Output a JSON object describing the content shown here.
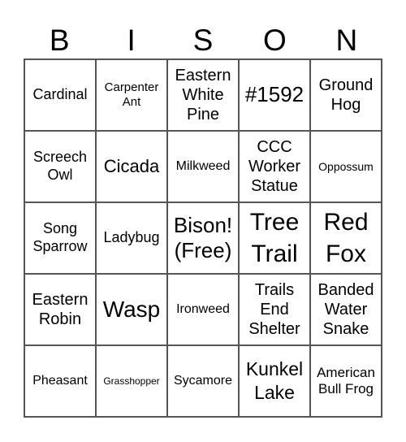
{
  "header": [
    "B",
    "I",
    "S",
    "O",
    "N"
  ],
  "cells": [
    "Cardinal",
    "Carpenter Ant",
    "Eastern White Pine",
    "#1592",
    "Ground Hog",
    "Screech Owl",
    "Cicada",
    "Milkweed",
    "CCC Worker Statue",
    "Oppossum",
    "Song Sparrow",
    "Ladybug",
    "Bison! (Free)",
    "Tree Trail",
    "Red Fox",
    "Eastern Robin",
    "Wasp",
    "Ironweed",
    "Trails End Shelter",
    "Banded Water Snake",
    "Pheasant",
    "Grasshopper",
    "Sycamore",
    "Kunkel Lake",
    "American Bull Frog"
  ]
}
